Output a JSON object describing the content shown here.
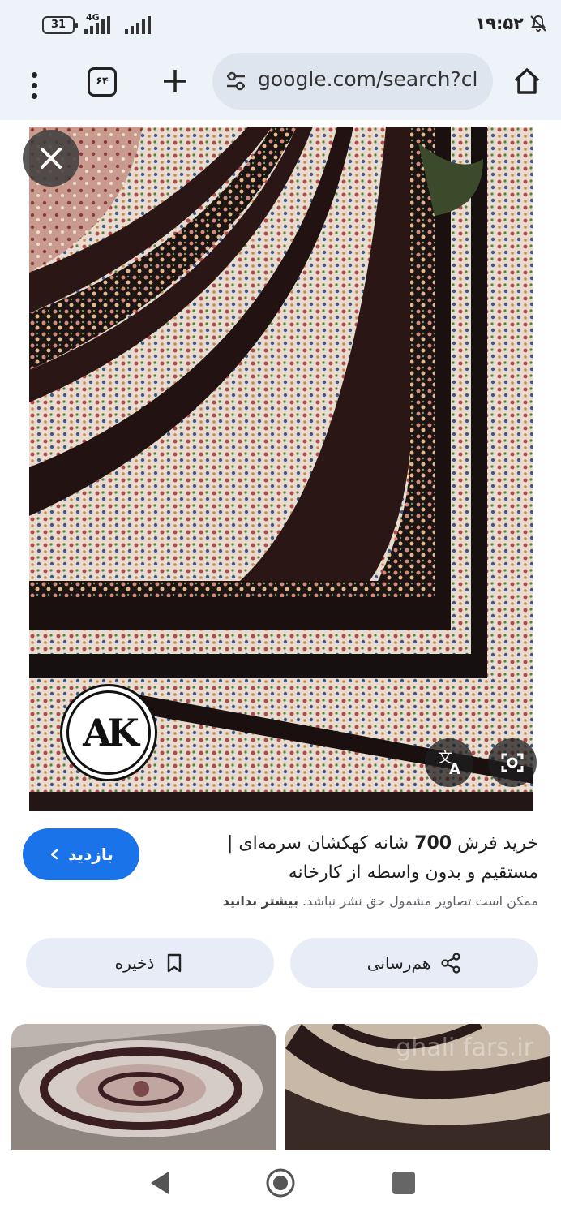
{
  "status_bar": {
    "battery": "31",
    "network": "4G",
    "time": "۱۹:۵۲"
  },
  "toolbar": {
    "tab_count": "۶۴",
    "url": "google.com/search?cl"
  },
  "result": {
    "visit_label": "بازدید",
    "title_prefix": "خرید فرش ",
    "title_bold": "700",
    "title_rest": " شانه کهکشان سرمه‌ای | مستقیم و بدون واسطه از کارخانه",
    "notice_text": "ممکن است تصاویر مشمول حق نشر نباشد. ",
    "notice_link": "بیشتر بدانید",
    "logo_text": "AK",
    "share_label": "هم‌رسانی",
    "save_label": "ذخیره"
  },
  "thumbnails": {
    "right_watermark": "ghali fars.ir"
  },
  "colors": {
    "accent": "#1a73e8",
    "toolbar_bg": "#eef3fa",
    "chip_bg": "#e7ecf6"
  }
}
